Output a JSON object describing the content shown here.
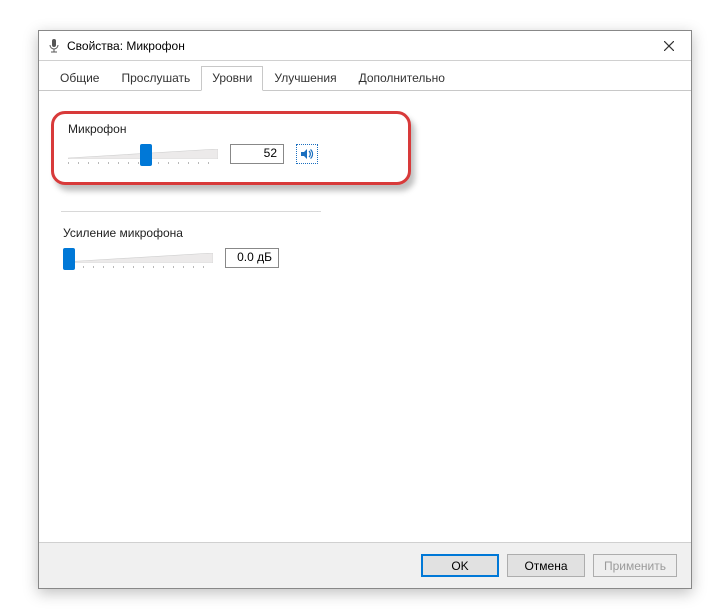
{
  "window": {
    "title": "Свойства: Микрофон"
  },
  "tabs": {
    "general": "Общие",
    "listen": "Прослушать",
    "levels": "Уровни",
    "enhancements": "Улучшения",
    "advanced": "Дополнительно"
  },
  "microphone_level": {
    "label": "Микрофон",
    "value": "52",
    "percent": 52
  },
  "microphone_gain": {
    "label": "Усиление микрофона",
    "value": "0.0 дБ",
    "percent": 0
  },
  "buttons": {
    "ok": "OK",
    "cancel": "Отмена",
    "apply": "Применить"
  }
}
